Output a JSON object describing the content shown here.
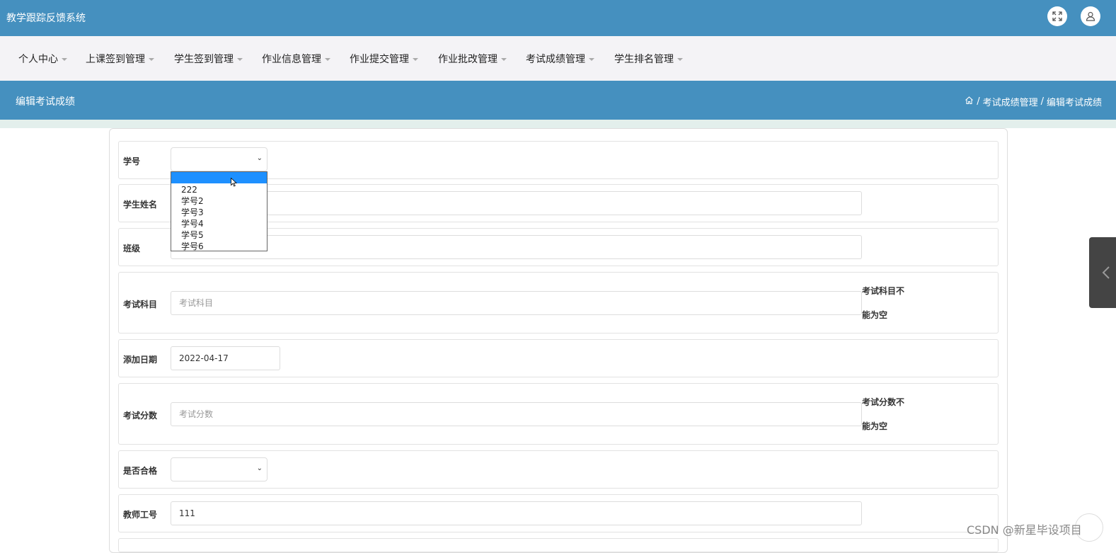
{
  "app": {
    "title": "教学跟踪反馈系统"
  },
  "topbar": {
    "icons": [
      "fullscreen-icon",
      "user-icon"
    ]
  },
  "nav": {
    "items": [
      {
        "label": "个人中心"
      },
      {
        "label": "上课签到管理"
      },
      {
        "label": "学生签到管理"
      },
      {
        "label": "作业信息管理"
      },
      {
        "label": "作业提交管理"
      },
      {
        "label": "作业批改管理"
      },
      {
        "label": "考试成绩管理"
      },
      {
        "label": "学生排名管理"
      }
    ]
  },
  "page": {
    "title": "编辑考试成绩",
    "breadcrumb": [
      "考试成绩管理",
      "编辑考试成绩"
    ],
    "breadcrumb_sep": "/"
  },
  "form": {
    "student_id": {
      "label": "学号",
      "value": "",
      "options": [
        "",
        "222",
        "学号2",
        "学号3",
        "学号4",
        "学号5",
        "学号6"
      ]
    },
    "student_name": {
      "label": "学生姓名",
      "value": ""
    },
    "class": {
      "label": "班级",
      "value": ""
    },
    "subject": {
      "label": "考试科目",
      "placeholder": "考试科目",
      "error": "考试科目不能为空"
    },
    "date": {
      "label": "添加日期",
      "value": "2022-04-17"
    },
    "score": {
      "label": "考试分数",
      "placeholder": "考试分数",
      "error": "考试分数不能为空"
    },
    "passed": {
      "label": "是否合格",
      "value": ""
    },
    "teacher_id": {
      "label": "教师工号",
      "value": "111"
    }
  },
  "watermark": "CSDN @新星毕设项目",
  "colors": {
    "primary": "#4590bf",
    "nav_bg": "#f4f3f6",
    "selected_option": "#1e90ff"
  }
}
